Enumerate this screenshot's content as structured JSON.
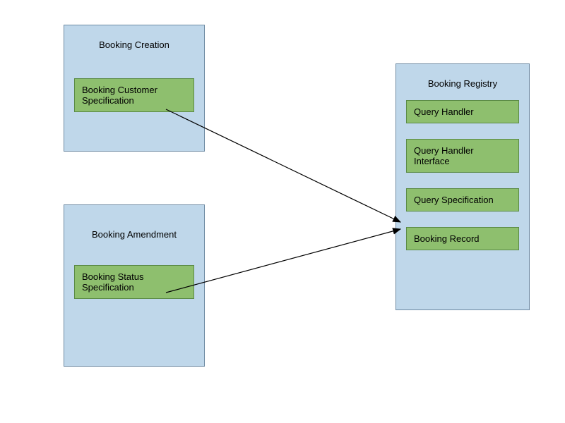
{
  "modules": {
    "creation": {
      "title": "Booking Creation",
      "items": [
        "Booking Customer Specification"
      ]
    },
    "amendment": {
      "title": "Booking Amendment",
      "items": [
        "Booking Status Specification"
      ]
    },
    "registry": {
      "title": "Booking Registry",
      "items": [
        "Query Handler",
        "Query Handler Interface",
        "Query Specification",
        "Booking Record"
      ]
    }
  },
  "arrows": [
    {
      "from": "creation.item0",
      "to": "registry.querySpecification"
    },
    {
      "from": "amendment.item0",
      "to": "registry.querySpecification"
    }
  ]
}
